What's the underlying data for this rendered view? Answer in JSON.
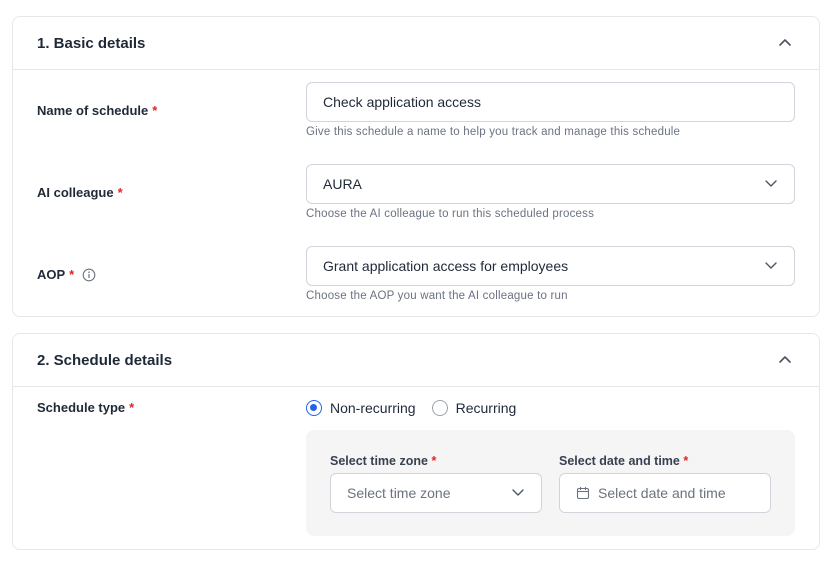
{
  "basic": {
    "title": "1. Basic details",
    "name_label": "Name of schedule",
    "name_value": "Check application access",
    "name_help": "Give this schedule a name to help you track and manage this schedule",
    "colleague_label": "AI colleague",
    "colleague_value": "AURA",
    "colleague_help": "Choose the AI colleague to run this scheduled process",
    "aop_label": "AOP",
    "aop_value": "Grant application access for employees",
    "aop_help": "Choose the AOP you want the AI colleague to run"
  },
  "schedule": {
    "title": "2. Schedule details",
    "type_label": "Schedule type",
    "options": [
      "Non-recurring",
      "Recurring"
    ],
    "selected": "Non-recurring",
    "timezone_label": "Select time zone",
    "timezone_placeholder": "Select time zone",
    "datetime_label": "Select date and time",
    "datetime_placeholder": "Select date and time"
  },
  "required_mark": "*",
  "colors": {
    "accent": "#2563eb",
    "required": "#dc2626",
    "panel": "#f5f5f5"
  },
  "icons": [
    "chevron-up-icon",
    "chevron-down-icon",
    "info-icon",
    "calendar-icon"
  ]
}
